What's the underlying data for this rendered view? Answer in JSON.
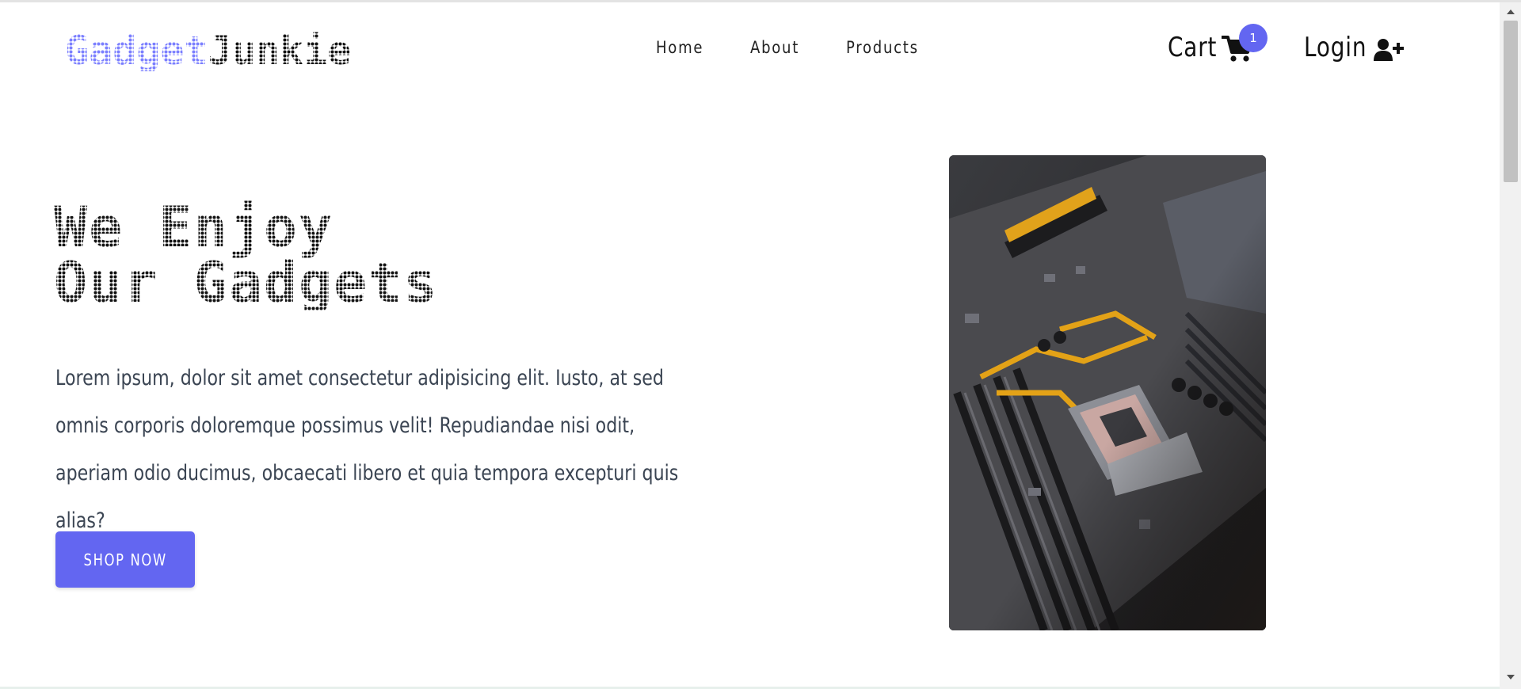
{
  "brand": {
    "part1": "Gadget",
    "part2": "Junkie"
  },
  "nav": {
    "items": [
      "Home",
      "About",
      "Products"
    ]
  },
  "cart": {
    "label": "Cart",
    "count": "1",
    "badge_color": "#6366f1"
  },
  "login": {
    "label": "Login"
  },
  "hero": {
    "title_line1": "We Enjoy",
    "title_line2": "Our Gadgets",
    "text": "Lorem ipsum, dolor sit amet consectetur adipisicing elit. Iusto, at sed omnis corporis doloremque possimus velit! Repudiandae nisi odit, aperiam odio ducimus, obcaecati libero et quia tempora excepturi quis alias?",
    "button_label": "SHOP NOW",
    "button_color": "#6366f1",
    "image": "motherboard-photo"
  },
  "icons": {
    "cart": "shopping-cart-icon",
    "login": "user-plus-icon"
  }
}
